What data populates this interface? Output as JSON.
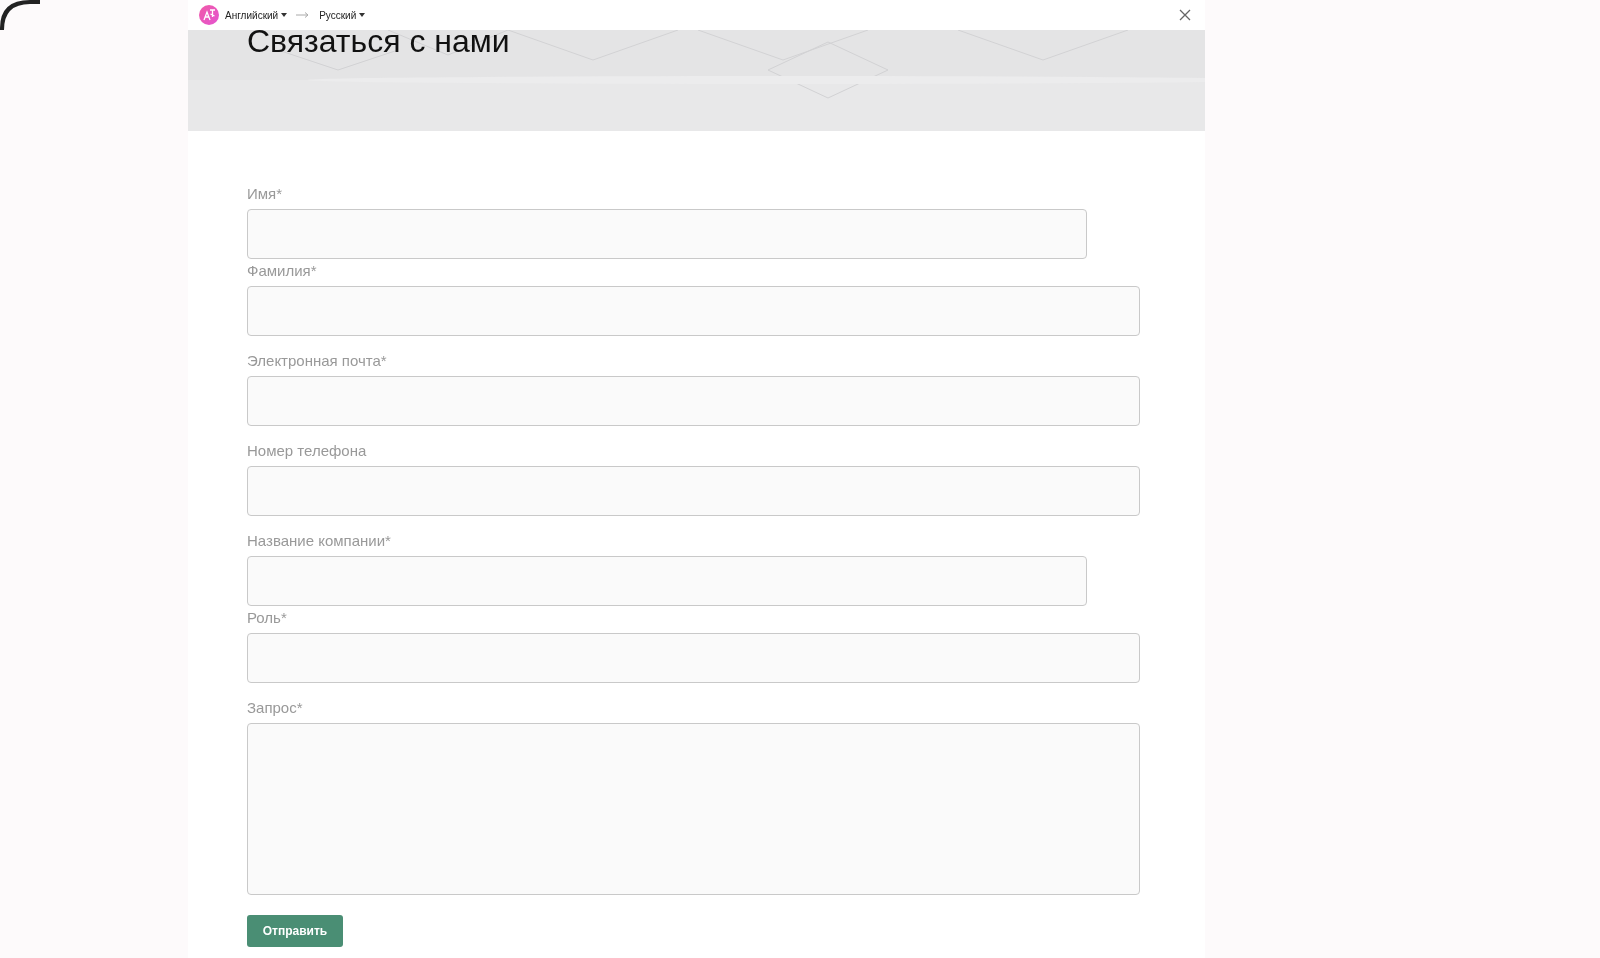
{
  "translate_bar": {
    "source_language": "Английский",
    "target_language": "Русский"
  },
  "header": {
    "title": "Связаться с нами"
  },
  "form": {
    "fields": [
      {
        "label": "Имя*",
        "kind": "narrow"
      },
      {
        "label": "Фамилия*",
        "kind": "wide"
      },
      {
        "label": "Электронная почта*",
        "kind": "wide"
      },
      {
        "label": "Номер телефона",
        "kind": "wide"
      },
      {
        "label": "Название компании*",
        "kind": "narrow"
      },
      {
        "label": "Роль*",
        "kind": "wide"
      },
      {
        "label": "Запрос*",
        "kind": "textarea"
      }
    ],
    "submit": "Отправить"
  }
}
